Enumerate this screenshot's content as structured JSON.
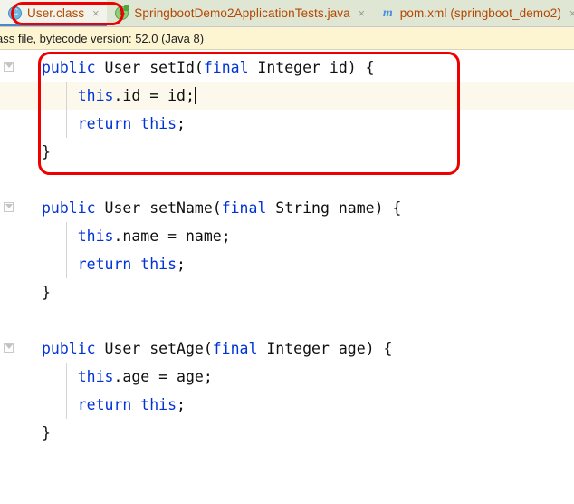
{
  "tabs": [
    {
      "label": "User.class",
      "icon": "java-class-icon",
      "icon_letter": "C",
      "active": true,
      "close": "×"
    },
    {
      "label": "SpringbootDemo2ApplicationTests.java",
      "icon": "java-test-class-icon",
      "icon_letter": "C",
      "active": false,
      "close": "×"
    },
    {
      "label": "pom.xml (springboot_demo2)",
      "icon": "maven-icon",
      "icon_letter": "m",
      "active": false,
      "close": "×"
    }
  ],
  "notification": {
    "text": "ass file, bytecode version: 52.0 (Java 8)"
  },
  "code": {
    "lines": [
      [
        {
          "t": "public",
          "c": "kw"
        },
        {
          "t": " User setId(",
          "c": "plain"
        },
        {
          "t": "final",
          "c": "kw"
        },
        {
          "t": " Integer id) {",
          "c": "plain"
        }
      ],
      [
        {
          "t": "    ",
          "c": "plain"
        },
        {
          "t": "this",
          "c": "kw2"
        },
        {
          "t": ".id = id;",
          "c": "plain"
        }
      ],
      [
        {
          "t": "    ",
          "c": "plain"
        },
        {
          "t": "return",
          "c": "kw"
        },
        {
          "t": " ",
          "c": "plain"
        },
        {
          "t": "this",
          "c": "kw2"
        },
        {
          "t": ";",
          "c": "plain"
        }
      ],
      [
        {
          "t": "}",
          "c": "plain"
        }
      ],
      [],
      [
        {
          "t": "public",
          "c": "kw"
        },
        {
          "t": " User setName(",
          "c": "plain"
        },
        {
          "t": "final",
          "c": "kw"
        },
        {
          "t": " String name) {",
          "c": "plain"
        }
      ],
      [
        {
          "t": "    ",
          "c": "plain"
        },
        {
          "t": "this",
          "c": "kw2"
        },
        {
          "t": ".name = name;",
          "c": "plain"
        }
      ],
      [
        {
          "t": "    ",
          "c": "plain"
        },
        {
          "t": "return",
          "c": "kw"
        },
        {
          "t": " ",
          "c": "plain"
        },
        {
          "t": "this",
          "c": "kw2"
        },
        {
          "t": ";",
          "c": "plain"
        }
      ],
      [
        {
          "t": "}",
          "c": "plain"
        }
      ],
      [],
      [
        {
          "t": "public",
          "c": "kw"
        },
        {
          "t": " User setAge(",
          "c": "plain"
        },
        {
          "t": "final",
          "c": "kw"
        },
        {
          "t": " Integer age) {",
          "c": "plain"
        }
      ],
      [
        {
          "t": "    ",
          "c": "plain"
        },
        {
          "t": "this",
          "c": "kw2"
        },
        {
          "t": ".age = age;",
          "c": "plain"
        }
      ],
      [
        {
          "t": "    ",
          "c": "plain"
        },
        {
          "t": "return",
          "c": "kw"
        },
        {
          "t": " ",
          "c": "plain"
        },
        {
          "t": "this",
          "c": "kw2"
        },
        {
          "t": ";",
          "c": "plain"
        }
      ],
      [
        {
          "t": "}",
          "c": "plain"
        }
      ]
    ],
    "caret_line": 1,
    "highlight_line": 1
  },
  "gutter": {
    "fold_markers": [
      0,
      5,
      10
    ],
    "icon": "code-fold-icon"
  },
  "annotations": [
    {
      "name": "highlight-ellipse-active-tab",
      "shape": "ellipse",
      "color": "#ef0000"
    },
    {
      "name": "highlight-rect-setid-method",
      "shape": "rounded-rect",
      "color": "#ef0000"
    }
  ],
  "colors": {
    "tabbar_bg": "#dfe6d4",
    "tab_active_bg": "#f2f4ec",
    "tab_text": "#b34700",
    "tab_underline": "#4a86c8",
    "notification_bg": "#fdf5d1",
    "keyword": "#0033d6",
    "plain_text": "#101010",
    "current_line": "#fcf9ec",
    "annotation": "#ef0000"
  }
}
